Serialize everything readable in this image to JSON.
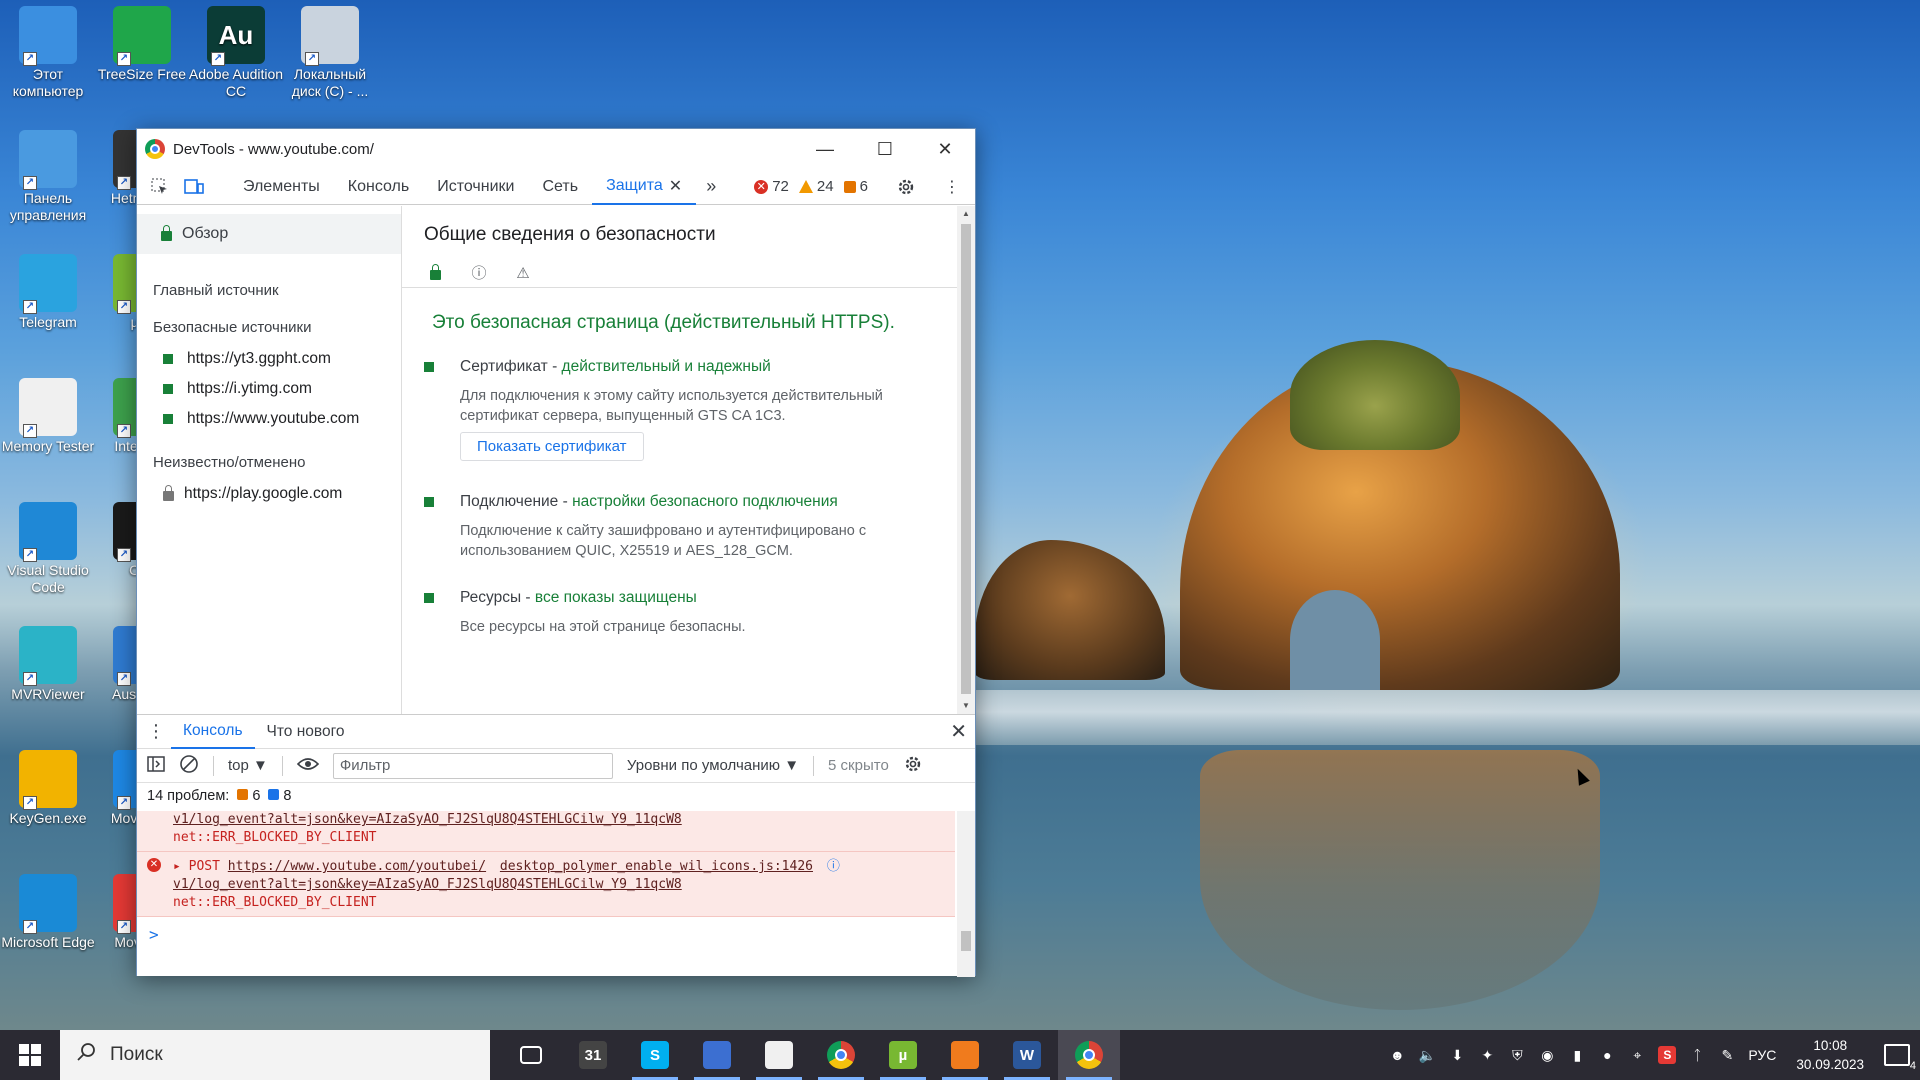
{
  "desktop": {
    "icons": [
      {
        "label": "Этот компьютер",
        "icon": "computer-icon",
        "color": "#3b8fe0"
      },
      {
        "label": "TreeSize Free",
        "icon": "treesize-icon",
        "color": "#1fa64a"
      },
      {
        "label": "Adobe Audition CC",
        "icon": "audition-icon",
        "color": "#0b3c36",
        "glyph": "Au"
      },
      {
        "label": "Локальный диск (C) - ...",
        "icon": "drive-icon",
        "color": "#c9d3de"
      },
      {
        "label": "Панель управления",
        "icon": "control-panel-icon",
        "color": "#4a9ae0"
      },
      {
        "label": "Hetm Rec",
        "icon": "app-icon",
        "color": "#333333"
      },
      {
        "label": "Telegram",
        "icon": "telegram-icon",
        "color": "#2aa3df"
      },
      {
        "label": "µTo",
        "icon": "utorrent-icon",
        "color": "#78b832"
      },
      {
        "label": "Memory Tester",
        "icon": "memory-tester-icon",
        "color": "#f0f0f0"
      },
      {
        "label": "Inte Dow",
        "icon": "download-icon",
        "color": "#3da14c"
      },
      {
        "label": "Visual Studio Code",
        "icon": "vscode-icon",
        "color": "#1f88d6"
      },
      {
        "label": "Ozo",
        "icon": "app-icon",
        "color": "#1a1a1a"
      },
      {
        "label": "MVRViewer",
        "icon": "mvrviewer-icon",
        "color": "#2bb3c7"
      },
      {
        "label": "Aus Boos",
        "icon": "app-icon",
        "color": "#2f7bd1"
      },
      {
        "label": "KeyGen.exe",
        "icon": "key-icon",
        "color": "#f2b300"
      },
      {
        "label": "Mova Edit",
        "icon": "app-icon",
        "color": "#1e88e5"
      },
      {
        "label": "Microsoft Edge",
        "icon": "edge-icon",
        "color": "#1a8ad6"
      },
      {
        "label": "Mova Ed",
        "icon": "app-icon",
        "color": "#e53935"
      }
    ]
  },
  "window": {
    "title": "DevTools - www.youtube.com/",
    "tabs": [
      "Элементы",
      "Консоль",
      "Источники",
      "Сеть",
      "Защита"
    ],
    "active_tab": "Защита",
    "counts": {
      "errors": "72",
      "warnings": "24",
      "issues": "6"
    }
  },
  "security": {
    "sidebar": {
      "overview": "Обзор",
      "main_origin_heading": "Главный источник",
      "secure_heading": "Безопасные источники",
      "secure_origins": [
        "https://yt3.ggpht.com",
        "https://i.ytimg.com",
        "https://www.youtube.com"
      ],
      "unknown_heading": "Неизвестно/отменено",
      "unknown_origins": [
        "https://play.google.com"
      ]
    },
    "title": "Общие сведения о безопасности",
    "secure_message": "Это безопасная страница (действительный HTTPS).",
    "certificate": {
      "label": "Сертификат - ",
      "status": "действительный и надежный",
      "description": "Для подключения к этому сайту используется действительный сертификат сервера, выпущенный GTS CA 1C3.",
      "button": "Показать сертификат"
    },
    "connection": {
      "label": "Подключение - ",
      "status": "настройки безопасного подключения",
      "description": "Подключение к сайту зашифровано и аутентифицировано с использованием QUIC, X25519 и AES_128_GCM."
    },
    "resources": {
      "label": "Ресурсы - ",
      "status": "все показы защищены",
      "description": "Все ресурсы на этой странице безопасны."
    }
  },
  "drawer": {
    "tabs": [
      "Консоль",
      "Что нового"
    ],
    "toolbar": {
      "context": "top",
      "filter_placeholder": "Фильтр",
      "levels": "Уровни по умолчанию",
      "hidden": "5 скрыто"
    },
    "problems": {
      "label": "14 проблем:",
      "warnings": "6",
      "info": "8"
    },
    "log": [
      {
        "method": "",
        "url": "",
        "source": "",
        "path": "v1/log_event?alt=json&key=AIzaSyAO_FJ2SlqU8Q4STEHLGCilw_Y9_11qcW8",
        "error": "net::ERR_BLOCKED_BY_CLIENT"
      },
      {
        "method": "POST",
        "url": "https://www.youtube.com/youtubei/",
        "source": "desktop_polymer_enable_wil_icons.js:1426",
        "path": "v1/log_event?alt=json&key=AIzaSyAO_FJ2SlqU8Q4STEHLGCilw_Y9_11qcW8",
        "error": "net::ERR_BLOCKED_BY_CLIENT"
      }
    ],
    "prompt": ">"
  },
  "taskbar": {
    "search": "Поиск",
    "apps": [
      {
        "icon": "task-view-icon",
        "color": "#2b2a33"
      },
      {
        "icon": "calendar-icon",
        "color": "#444444",
        "glyph": "31"
      },
      {
        "icon": "skype-icon",
        "color": "#00aff0",
        "glyph": "S"
      },
      {
        "icon": "notepad-icon",
        "color": "#3c6fd1"
      },
      {
        "icon": "fox-icon",
        "color": "#f0f0f0"
      },
      {
        "icon": "chrome-icon",
        "color": "#4285f4"
      },
      {
        "icon": "utorrent-icon",
        "color": "#78b832",
        "glyph": "µ"
      },
      {
        "icon": "app-orange-icon",
        "color": "#f07b1d"
      },
      {
        "icon": "word-icon",
        "color": "#2b579a",
        "glyph": "W"
      },
      {
        "icon": "chrome-icon",
        "color": "#4285f4"
      }
    ],
    "language": "РУС",
    "time": "10:08",
    "date": "30.09.2023",
    "notifications": "4"
  }
}
